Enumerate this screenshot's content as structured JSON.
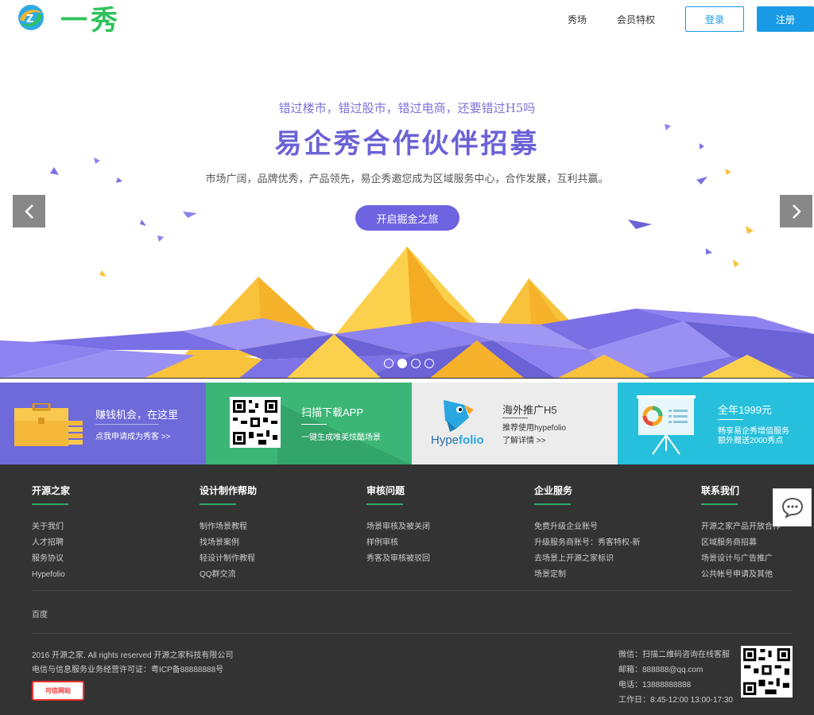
{
  "header": {
    "logo_text": "一秀",
    "nav": [
      {
        "label": "秀场"
      },
      {
        "label": "会员特权"
      }
    ],
    "login_label": "登录",
    "register_label": "注册"
  },
  "banner": {
    "subtitle": "错过楼市，错过股市，错过电商，还要错过H5吗",
    "title": "易企秀合作伙伴招募",
    "desc": "市场广阔，品牌优秀，产品领先，易企秀邀您成为区域服务中心，合作发展，互利共赢。",
    "cta": "开启掘金之旅",
    "slide_count": 4,
    "active_slide": 1,
    "colors": {
      "purple": "#6e63e0",
      "gold": "#f9c23c",
      "violet": "#8d82ef"
    }
  },
  "cards": [
    {
      "title": "赚钱机会，在这里",
      "sub": "点我申请成为秀客 >>",
      "icon": "briefcase-icon"
    },
    {
      "title": "扫描下载APP",
      "sub": "一键生成唯美炫酷场景",
      "icon": "qr-code-icon"
    },
    {
      "title": "海外推广H5",
      "sub1": "推荐使用hypefolio",
      "sub2": "了解详情 >>",
      "brand": "Hype",
      "brand2": "folio",
      "icon": "hypefolio-bird-icon"
    },
    {
      "title": "全年1999元",
      "sub1": "畅享易企秀增值服务",
      "sub2": "额外赠送2000秀点",
      "icon": "presentation-board-icon"
    }
  ],
  "footer": {
    "columns": [
      {
        "title": "开源之家",
        "links": [
          "关于我们",
          "人才招聘",
          "服务协议",
          "Hypefolio"
        ]
      },
      {
        "title": "设计制作帮助",
        "links": [
          "制作场景教程",
          "找场景案例",
          "轻设计制作教程",
          "QQ群交流"
        ]
      },
      {
        "title": "审核问题",
        "links": [
          "场景审核及被关闭",
          "样例审核",
          "秀客及审核被驳回"
        ]
      },
      {
        "title": "企业服务",
        "links": [
          "免费升级企业账号",
          "升级服务商账号：秀客特权-新",
          "去场景上开源之家标识",
          "场景定制"
        ]
      },
      {
        "title": "联系我们",
        "links": [
          "开源之家产品开放合作",
          "区域服务商招募",
          "场景设计与广告推广",
          "公共帐号申请及其他"
        ]
      }
    ],
    "friend_link": "百度",
    "copyright": "2016 开源之家. All rights reserved 开源之家科技有限公司",
    "license": "电信与信息服务业务经营许可证：粤ICP备88888888号",
    "badge_text": "可信网站",
    "contact": [
      "微信：扫描二维码咨询在线客服",
      "邮箱：888888@qq.com",
      "电话：13888888888",
      "工作日：8:45-12:00 13:00-17:30"
    ]
  }
}
